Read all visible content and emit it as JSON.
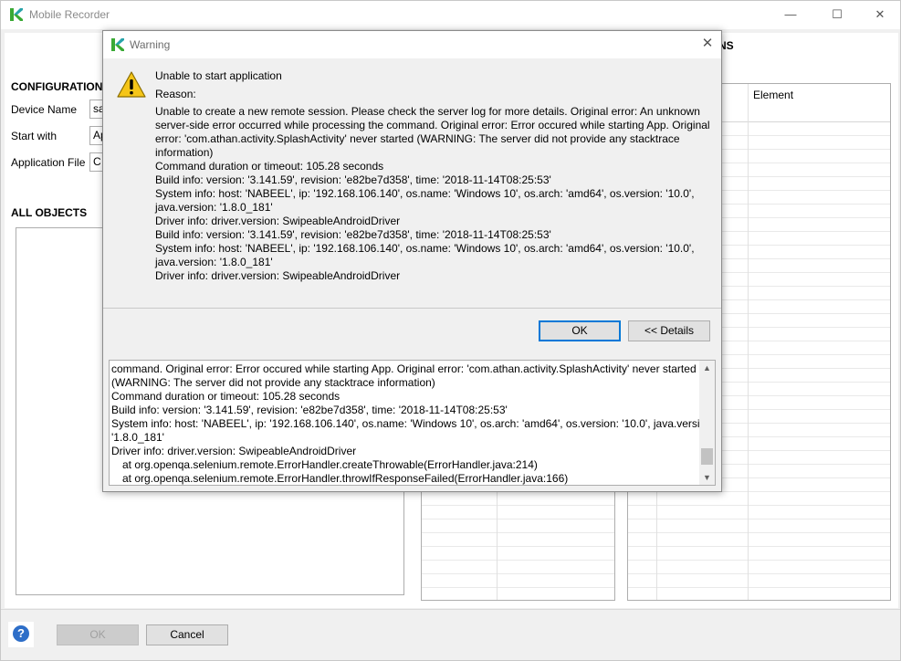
{
  "window": {
    "title": "Mobile Recorder",
    "minimize_glyph": "—",
    "maximize_glyph": "☐",
    "close_glyph": "✕"
  },
  "configurations": {
    "title": "CONFIGURATIONS",
    "device_name_label": "Device Name",
    "device_name_value": "sa",
    "start_with_label": "Start with",
    "start_with_value": "Ap",
    "application_file_label": "Application File",
    "application_file_value": "C"
  },
  "all_objects": {
    "title": "ALL OBJECTS"
  },
  "actions_panel": {
    "title_fragment": "NS",
    "element_column": "Element"
  },
  "footer": {
    "ok_label": "OK",
    "cancel_label": "Cancel",
    "help_glyph": "?"
  },
  "dialog": {
    "title": "Warning",
    "close_glyph": "✕",
    "heading": "Unable to start application",
    "reason_label": "Reason:",
    "message_lines": [
      "Unable to create a new remote session. Please check the server log for more details. Original error: An unknown",
      "server-side error occurred while processing the command. Original error: Error occured while starting App. Original",
      "error: 'com.athan.activity.SplashActivity' never started (WARNING: The server did not provide any stacktrace",
      "information)",
      "Command duration or timeout: 105.28 seconds",
      "Build info: version: '3.141.59', revision: 'e82be7d358', time: '2018-11-14T08:25:53'",
      "System info: host: 'NABEEL', ip: '192.168.106.140', os.name: 'Windows 10', os.arch: 'amd64', os.version: '10.0',",
      "java.version: '1.8.0_181'",
      "Driver info: driver.version: SwipeableAndroidDriver",
      "Build info: version: '3.141.59', revision: 'e82be7d358', time: '2018-11-14T08:25:53'",
      "System info: host: 'NABEEL', ip: '192.168.106.140', os.name: 'Windows 10', os.arch: 'amd64', os.version: '10.0',",
      "java.version: '1.8.0_181'",
      "Driver info: driver.version: SwipeableAndroidDriver"
    ],
    "ok_label": "OK",
    "details_label": "<< Details",
    "details_lines": [
      "command. Original error: Error occured while starting App. Original error: 'com.athan.activity.SplashActivity' never started",
      "(WARNING: The server did not provide any stacktrace information)",
      "Command duration or timeout: 105.28 seconds",
      "Build info: version: '3.141.59', revision: 'e82be7d358', time: '2018-11-14T08:25:53'",
      "System info: host: 'NABEEL', ip: '192.168.106.140', os.name: 'Windows 10', os.arch: 'amd64', os.version: '10.0', java.version:",
      "'1.8.0_181'",
      "Driver info: driver.version: SwipeableAndroidDriver"
    ],
    "details_stack_lines": [
      "at org.openqa.selenium.remote.ErrorHandler.createThrowable(ErrorHandler.java:214)",
      "at org.openqa.selenium.remote.ErrorHandler.throwIfResponseFailed(ErrorHandler.java:166)"
    ],
    "scroll_up_glyph": "▲",
    "scroll_down_glyph": "▼"
  },
  "colors": {
    "accent": "#0078d7",
    "help_blue": "#2d6ec8",
    "warning_yellow": "#f5c518",
    "logo_green": "#3aaa35"
  }
}
